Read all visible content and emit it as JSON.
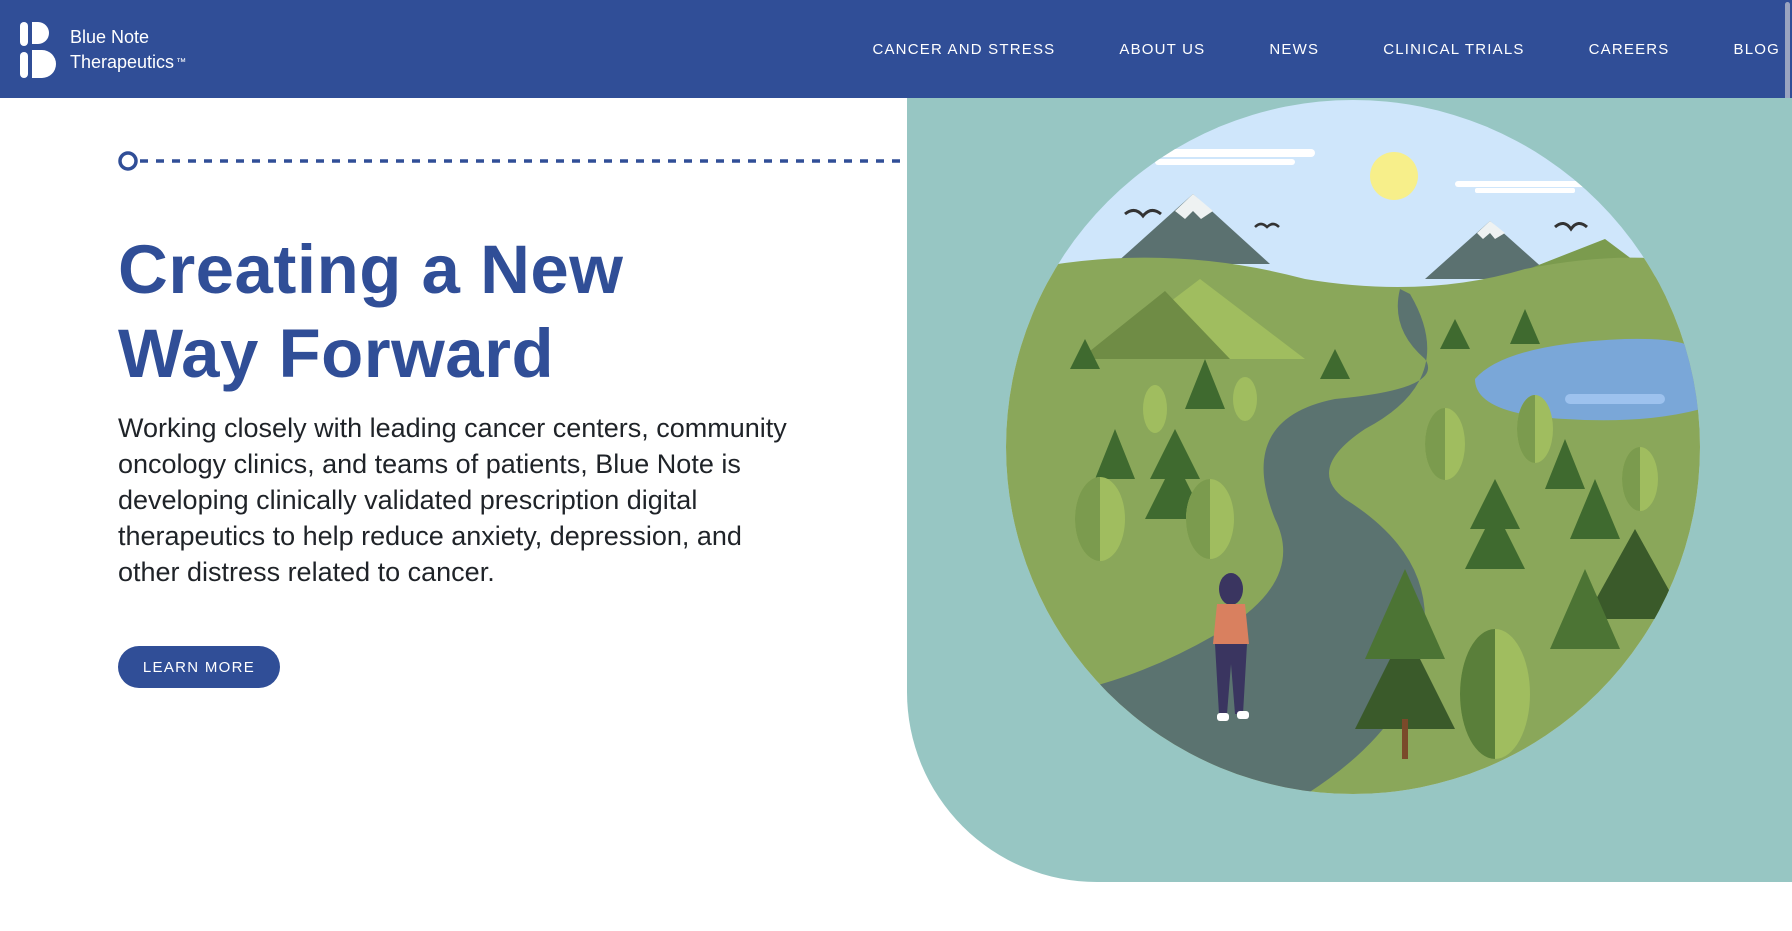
{
  "brand": {
    "name_line1": "Blue Note",
    "name_line2": "Therapeutics",
    "trademark": "™",
    "primary_color": "#304e97",
    "accent_bg_color": "#97c6c3"
  },
  "nav": {
    "items": [
      {
        "label": "CANCER AND STRESS"
      },
      {
        "label": "ABOUT US"
      },
      {
        "label": "NEWS"
      },
      {
        "label": "CLINICAL TRIALS"
      },
      {
        "label": "CAREERS"
      },
      {
        "label": "BLOG"
      }
    ]
  },
  "hero": {
    "headline_line1": "Creating a New",
    "headline_line2": "Way Forward",
    "body": "Working closely with leading cancer centers, community oncology clinics, and teams of patients, Blue Note is developing clinically validated prescription digital therapeutics to help reduce anxiety, depression, and other distress related to cancer.",
    "cta_label": "LEARN MORE",
    "illustration": "woman-on-winding-path-through-forest-illustration"
  }
}
